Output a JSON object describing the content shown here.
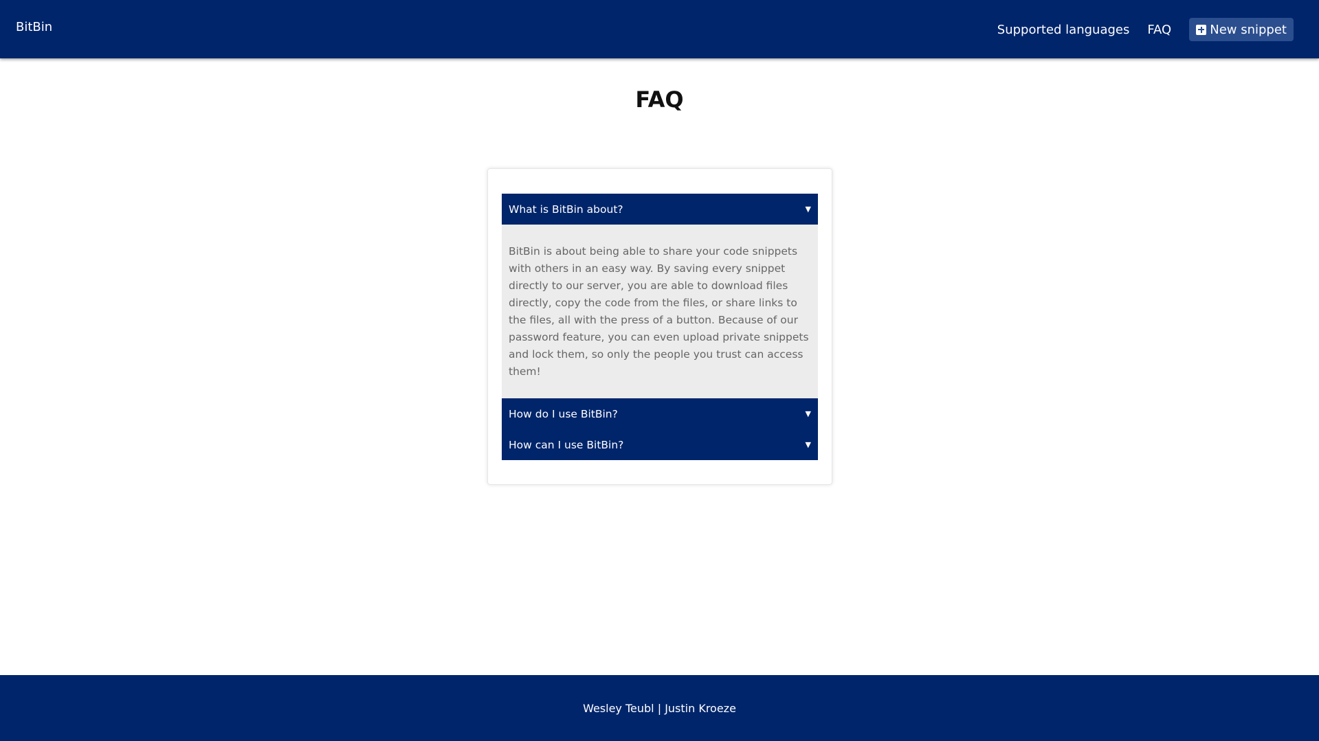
{
  "navbar": {
    "brand": "BitBin",
    "links": {
      "supported_languages": "Supported languages",
      "faq": "FAQ"
    },
    "new_snippet_label": "New snippet",
    "background": "#00256b",
    "button_background": "#2b4e8f"
  },
  "page": {
    "title": "FAQ"
  },
  "faq": {
    "items": [
      {
        "question": "What is BitBin about?",
        "answer": "BitBin is about being able to share your code snippets with others in an easy way. By saving every snippet directly to our server, you are able to download files directly, copy the code from the files, or share links to the files, all with the press of a button. Because of our password feature, you can even upload private snippets and lock them, so only the people you trust can access them!",
        "expanded": true
      },
      {
        "question": "How do I use BitBin?",
        "expanded": false
      },
      {
        "question": "How can I use BitBin?",
        "expanded": false
      }
    ],
    "arrow_icon": "▼"
  },
  "footer": {
    "text": "Wesley Teubl | Justin Kroeze"
  }
}
